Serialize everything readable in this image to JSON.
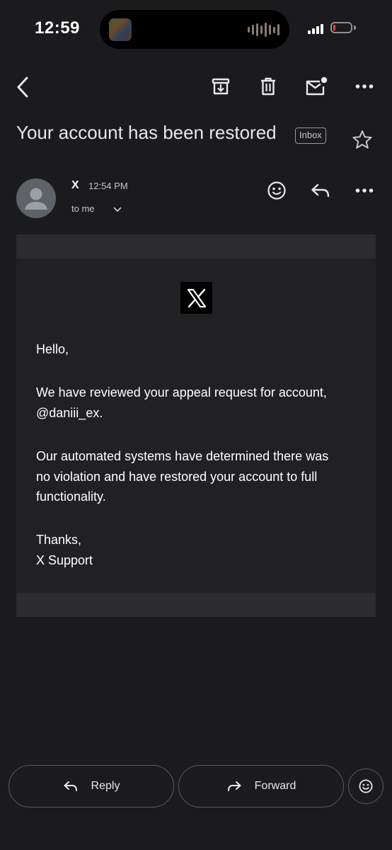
{
  "status_bar": {
    "time": "12:59",
    "battery_level": 0.1,
    "battery_color": "#ff3b30",
    "signal_bars": 4
  },
  "toolbar": {
    "icons": [
      "back-icon",
      "archive-icon",
      "trash-icon",
      "mark-unread-icon",
      "more-icon"
    ]
  },
  "email": {
    "subject": "Your account has been restored",
    "label": "Inbox",
    "starred": false,
    "sender": {
      "name": "X",
      "time": "12:54 PM",
      "recipient": "to me"
    },
    "logo_icon": "x-logo-icon",
    "body": {
      "greeting": "Hello,",
      "paragraph1_line1": "We have reviewed your appeal request for account,",
      "paragraph1_line2": "@daniii_ex.",
      "paragraph2_line1": "Our automated systems have determined there was",
      "paragraph2_line2": "no violation and have restored your account to full",
      "paragraph2_line3": "functionality.",
      "signoff": "Thanks,",
      "signature": "X Support"
    }
  },
  "actions": {
    "reply_label": "Reply",
    "forward_label": "Forward"
  },
  "colors": {
    "background": "#1b1b1d",
    "email_frame": "#2c2c2e",
    "email_body": "#212124",
    "text": "#ffffff"
  }
}
